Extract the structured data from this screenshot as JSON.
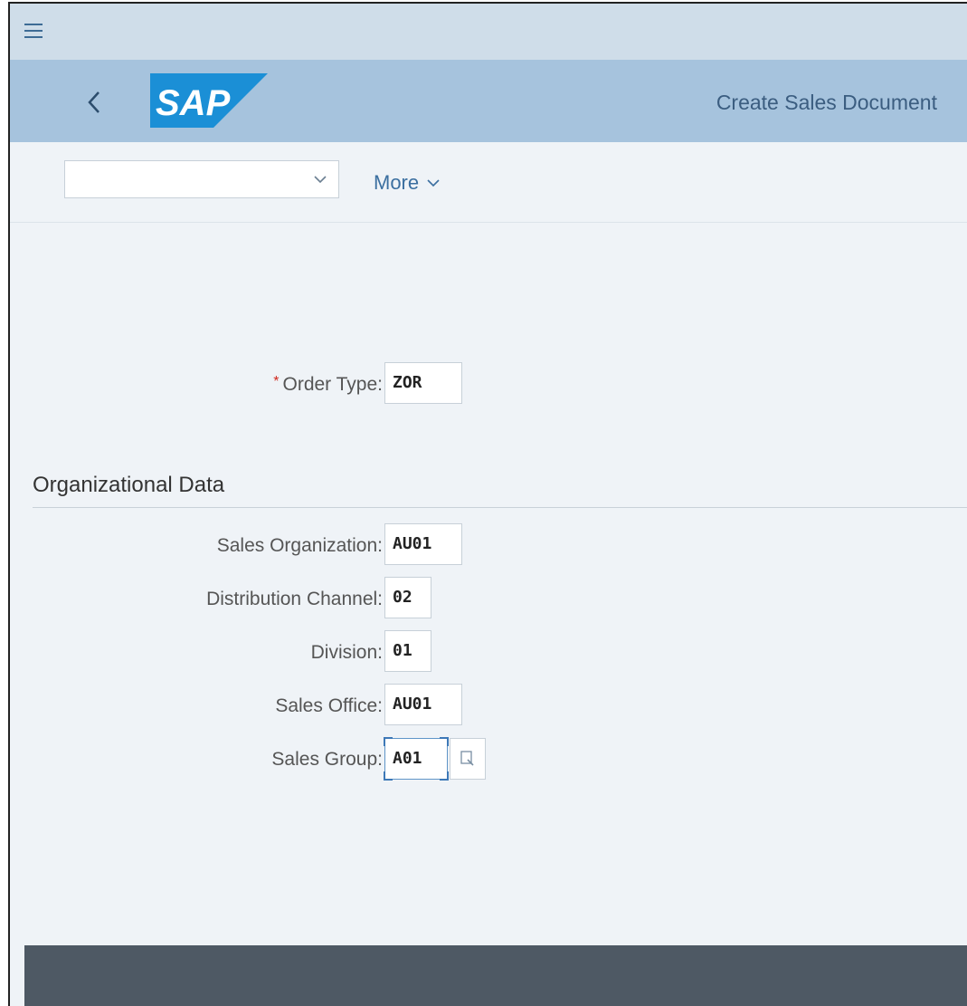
{
  "header": {
    "title": "Create Sales Document",
    "logo_text": "SAP"
  },
  "toolbar": {
    "select_value": "",
    "more_label": "More"
  },
  "order_type": {
    "label": "Order Type:",
    "required_marker": "*",
    "value": "ZOR"
  },
  "org_data": {
    "section_title": "Organizational Data",
    "fields": [
      {
        "label": "Sales Organization:",
        "value": "AU01"
      },
      {
        "label": "Distribution Channel:",
        "value": "02"
      },
      {
        "label": "Division:",
        "value": "01"
      },
      {
        "label": "Sales Office:",
        "value": "AU01"
      },
      {
        "label": "Sales Group:",
        "value": "A01"
      }
    ]
  },
  "colors": {
    "shell_bar": "#cfdde9",
    "header_bar": "#a6c3dd",
    "sap_logo": "#1b8fd6",
    "footer": "#4e5964",
    "required": "#d0271d"
  },
  "icons": [
    "menu-icon",
    "back-icon",
    "chevron-down-icon",
    "value-help-icon"
  ]
}
